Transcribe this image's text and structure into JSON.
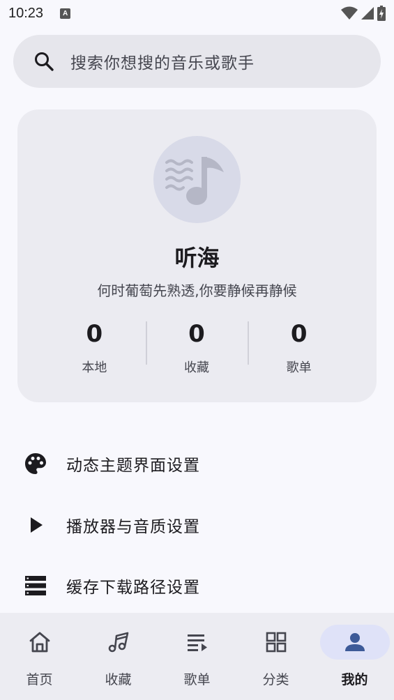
{
  "status_bar": {
    "time": "10:23",
    "notification_badge": "A"
  },
  "search": {
    "placeholder": "搜索你想搜的音乐或歌手",
    "icon": "search-icon"
  },
  "profile": {
    "name": "听海",
    "motto": "何时葡萄先熟透,你要静候再静候",
    "avatar_icon": "music-note-waves-icon",
    "stats": [
      {
        "value": "0",
        "label": "本地"
      },
      {
        "value": "0",
        "label": "收藏"
      },
      {
        "value": "0",
        "label": "歌单"
      }
    ]
  },
  "settings": [
    {
      "label": "动态主题界面设置",
      "icon": "palette-icon"
    },
    {
      "label": "播放器与音质设置",
      "icon": "play-icon"
    },
    {
      "label": "缓存下载路径设置",
      "icon": "storage-list-icon"
    }
  ],
  "bottom_nav": [
    {
      "label": "首页",
      "icon": "home-icon",
      "active": false
    },
    {
      "label": "收藏",
      "icon": "music-notes-icon",
      "active": false
    },
    {
      "label": "歌单",
      "icon": "playlist-icon",
      "active": false
    },
    {
      "label": "分类",
      "icon": "grid-icon",
      "active": false
    },
    {
      "label": "我的",
      "icon": "person-icon",
      "active": true
    }
  ],
  "colors": {
    "background": "#f8f8fd",
    "surface": "#ebebf1",
    "accent": "#3d5a98",
    "active_pill": "#dfe2f8"
  }
}
